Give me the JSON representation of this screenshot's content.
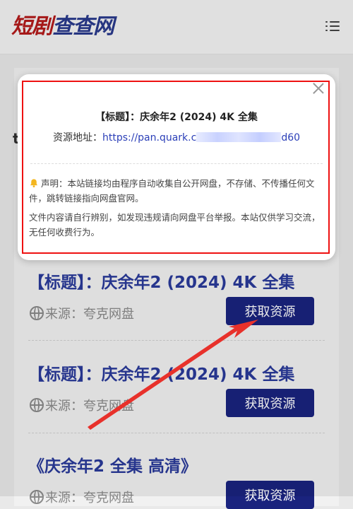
{
  "header": {
    "logo_part1": "短剧",
    "logo_part2": "查查网"
  },
  "page": {
    "partial_letter": "t"
  },
  "cards": [
    {
      "title": "【标题】：庆余年2 (2024) 4K 全集",
      "source": "来源：夸克网盘",
      "button": "获取资源"
    },
    {
      "title": "【标题】：庆余年2 (2024) 4K 全集",
      "source": "来源：夸克网盘",
      "button": "获取资源"
    },
    {
      "title": "《庆余年2 全集 高清》",
      "source": "来源：夸克网盘",
      "button": "获取资源"
    }
  ],
  "modal": {
    "title": "【标题】：庆余年2 (2024) 4K 全集",
    "address_label": "资源地址：",
    "url_prefix": "https://pan.quark.c",
    "url_suffix": "d60",
    "disclaimer_1": "声明：本站链接均由程序自动收集自公开网盘，不存储、不传播任何文件，跳转链接指向网盘官网。",
    "disclaimer_2": "文件内容请自行辨别，如发现违规请向网盘平台举报。本站仅供学习交流，无任何收费行为。"
  },
  "colors": {
    "accent_blue": "#1a237e",
    "title_blue": "#2a3a9a",
    "frame_red": "#e11111",
    "arrow_red": "#e8312b"
  }
}
